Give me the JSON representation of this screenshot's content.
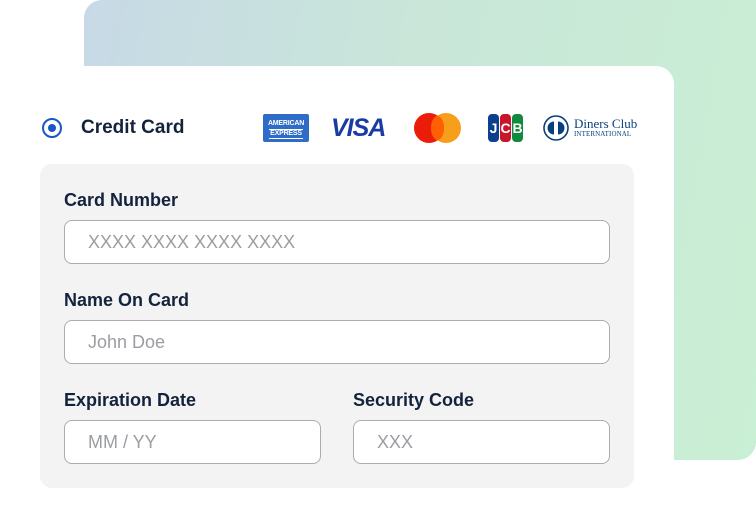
{
  "payment_method": {
    "label": "Credit Card",
    "selected": true,
    "accent_color": "#1a56c4"
  },
  "card_brands": {
    "amex": {
      "line1": "AMERICAN",
      "line2": "EXPRESS",
      "color": "#2f6cc7"
    },
    "visa": {
      "text": "VISA",
      "color": "#1a3ba6"
    },
    "mastercard": {
      "colors": [
        "#eb1c0a",
        "#f79e1b"
      ]
    },
    "jcb": {
      "letters": [
        "J",
        "C",
        "B"
      ],
      "colors": [
        "#0d3f8f",
        "#c9162b",
        "#128a3d"
      ]
    },
    "diners": {
      "name": "Diners Club",
      "subtitle": "INTERNATIONAL",
      "color": "#0a3f7d"
    }
  },
  "form": {
    "card_number": {
      "label": "Card Number",
      "placeholder": "XXXX XXXX XXXX XXXX",
      "value": ""
    },
    "name_on_card": {
      "label": "Name On Card",
      "placeholder": "John Doe",
      "value": ""
    },
    "expiration_date": {
      "label": "Expiration Date",
      "placeholder": "MM / YY",
      "value": ""
    },
    "security_code": {
      "label": "Security Code",
      "placeholder": "XXX",
      "value": ""
    }
  },
  "colors": {
    "text": "#14233c",
    "panel_bg": "#f3f3f4",
    "input_border": "#a9acb0",
    "placeholder": "#9a9da2"
  }
}
